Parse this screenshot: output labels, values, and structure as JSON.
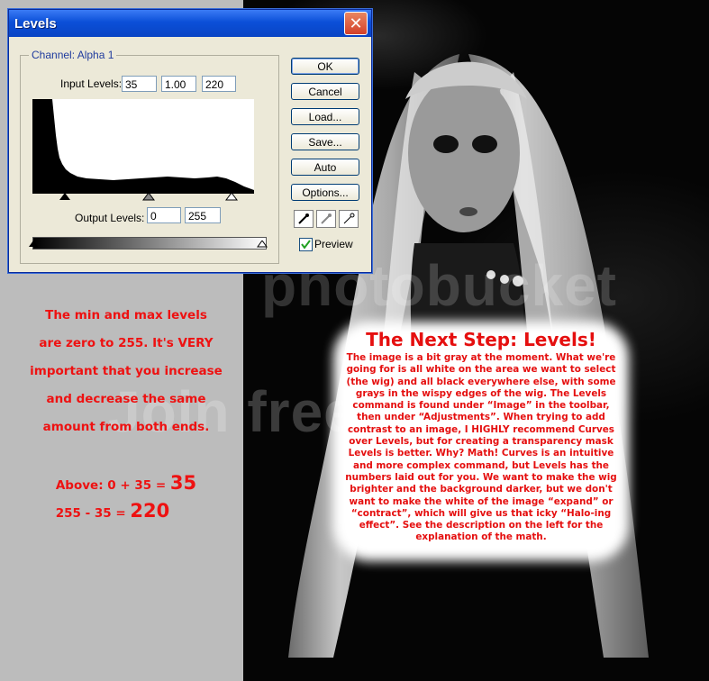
{
  "dialog": {
    "title": "Levels",
    "channel_label": "Channel:  Alpha 1",
    "input_levels_label": "Input Levels:",
    "input_black": "35",
    "input_gamma": "1.00",
    "input_white": "220",
    "output_levels_label": "Output Levels:",
    "output_black": "0",
    "output_white": "255",
    "buttons": {
      "ok": "OK",
      "cancel": "Cancel",
      "load": "Load...",
      "save": "Save...",
      "auto": "Auto",
      "options": "Options..."
    },
    "preview_label": "Preview",
    "preview_checked": true,
    "eyedroppers": [
      "black-eyedropper-icon",
      "gray-eyedropper-icon",
      "white-eyedropper-icon"
    ]
  },
  "explanation": {
    "line1": "The min and max levels",
    "line2": "are zero to 255. It's VERY",
    "line3": "important that you increase",
    "line4": "and decrease the same",
    "line5": "amount from both ends.",
    "math1_prefix": "Above:  0 + 35 = ",
    "math1_result": "35",
    "math2_prefix": "255 - 35 = ",
    "math2_result": "220"
  },
  "next_step": {
    "heading": "The Next Step: Levels!",
    "body": "The image is a bit gray at the moment.  What we're going for is all white on the area we want to select (the wig) and all black everywhere else, with some grays in the wispy edges of the wig.  The Levels command is found under “Image” in the toolbar, then under “Adjustments”.  When trying to add contrast to an image, I HIGHLY recommend Curves over Levels, but for creating a transparency mask Levels is better.  Why? Math!  Curves is an intuitive and more complex command, but Levels has the numbers laid out for you.  We want to make the wig brighter and the background darker, but we don't want to make the white of the image “expand” or “contract”, which will give us that icky “Halo-ing effect”.  See the description on the left for the explanation of the math."
  },
  "watermark": {
    "line1": "photobucket",
    "line2": "Join free. Share"
  },
  "colors": {
    "accent_red": "#ee1111",
    "xp_title_blue": "#0b4fd8",
    "dialog_bg": "#ece9d8"
  }
}
